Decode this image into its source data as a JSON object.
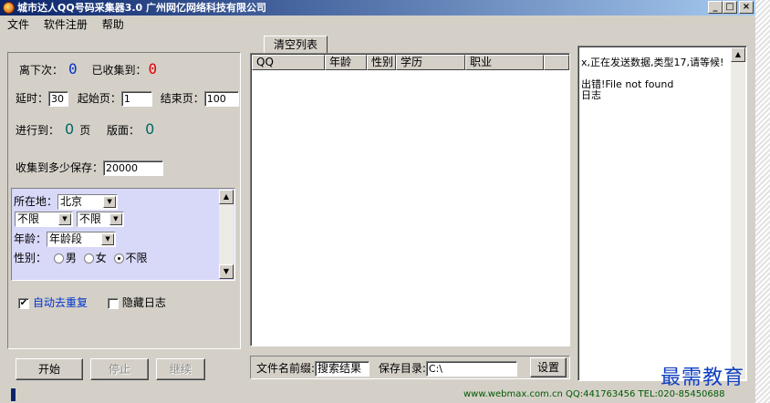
{
  "window": {
    "title": "城市达人QQ号码采集器3.0 广州网亿网络科技有限公司",
    "controls": {
      "minimize": "_",
      "maximize": "□",
      "close": "×"
    }
  },
  "menu": [
    "文件",
    "软件注册",
    "帮助"
  ],
  "stats": {
    "next_label": "离下次：",
    "next_value": "0",
    "collected_label": "已收集到：",
    "collected_value": "0",
    "delay_label": "延时：",
    "delay_value": "30",
    "start_page_label": "起始页：",
    "start_page_value": "1",
    "end_page_label": "结束页：",
    "end_page_value": "100",
    "progress_label": "进行到：",
    "progress_value": "0",
    "page_unit": "页",
    "layout_label": "版面：",
    "layout_value": "0",
    "save_every_label": "收集到多少保存：",
    "save_every_value": "20000"
  },
  "filters": {
    "location_label": "所在地：",
    "location_value": "北京",
    "sub1_value": "不限",
    "sub2_value": "不限",
    "age_label": "年龄：",
    "age_value": "年龄段",
    "gender_label": "性别：",
    "gender_options": [
      "男",
      "女",
      "不限"
    ],
    "gender_selected": "不限"
  },
  "options": {
    "auto_dedupe_label": "自动去重复",
    "auto_dedupe_checked": true,
    "hide_log_label": "隐藏日志",
    "hide_log_checked": false
  },
  "buttons": {
    "start": "开始",
    "stop": "停止",
    "resume": "继续",
    "clear_list": "清空列表",
    "settings": "设置"
  },
  "list": {
    "columns": [
      "QQ",
      "年龄",
      "性别",
      "学历",
      "职业"
    ],
    "rows": []
  },
  "save": {
    "prefix_label": "文件名前缀:",
    "prefix_value": "搜索结果",
    "dir_label": "保存目录:",
    "dir_value": "C:\\"
  },
  "log": {
    "lines": [
      "x,正在发送数据,类型17,请等候!",
      "",
      "出错!File not found",
      "日志"
    ]
  },
  "status": {
    "text": "www.webmax.com.cn  QQ:441763456  TEL:020-85450688"
  },
  "watermark": "最需教育",
  "colors": {
    "title_start": "#0a246a",
    "title_end": "#a6caf0",
    "counter_blue": "#0033cc",
    "counter_red": "#e00000",
    "filter_bg": "#d8d8f8",
    "status_green": "#005a00"
  }
}
